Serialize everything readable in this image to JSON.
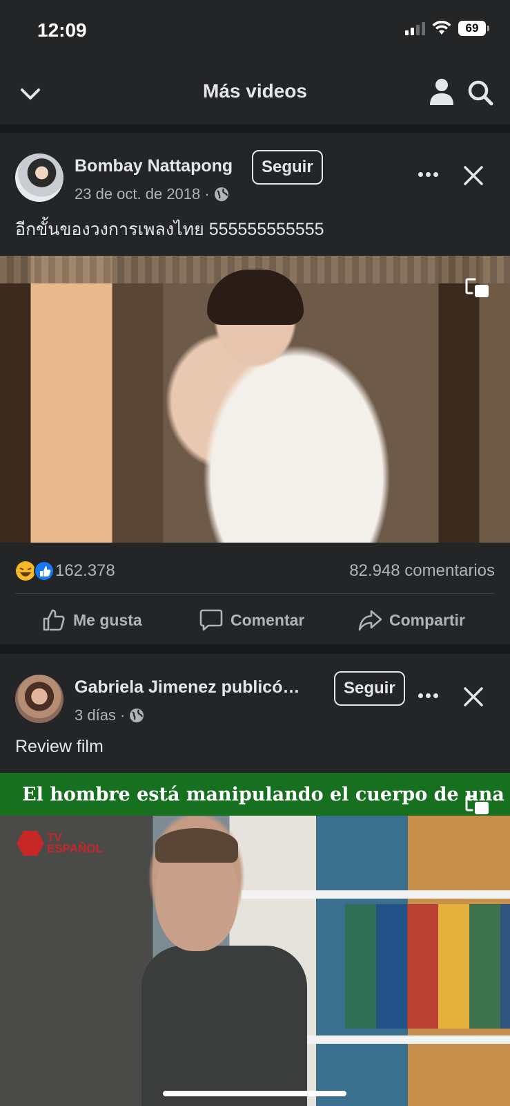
{
  "status_bar": {
    "time": "12:09",
    "battery": "69"
  },
  "nav": {
    "title": "Más videos"
  },
  "posts": [
    {
      "author": "Bombay Nattapong",
      "follow_label": "Seguir",
      "date": "23 de oct. de 2018 ·",
      "caption": "อีกขั้นของวงการเพลงไทย 555555555555",
      "reactions_count": "162.378",
      "comments_count": "82.948 comentarios"
    },
    {
      "author": "Gabriela Jimenez publicó…",
      "follow_label": "Seguir",
      "date": "3 días ·",
      "caption": "Review film",
      "video_banner": "El hombre está manipulando el cuerpo de una niña",
      "video_logo": [
        "TV",
        "ESPAÑOL"
      ]
    }
  ],
  "actions": {
    "like": "Me gusta",
    "comment": "Comentar",
    "share": "Compartir"
  },
  "colors": {
    "background": "#18191b",
    "card": "#242527",
    "text": "#e4e6eb",
    "muted": "#b0b3b8",
    "like_blue": "#1877f2",
    "banner_green": "#16701f"
  }
}
